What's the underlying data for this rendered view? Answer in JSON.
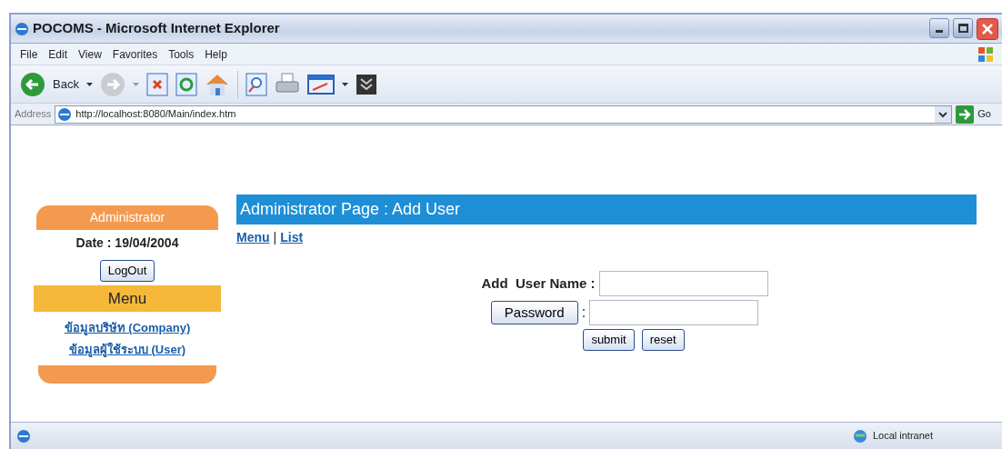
{
  "window": {
    "title": "POCOMS - Microsoft Internet Explorer"
  },
  "menu_bar": [
    "File",
    "Edit",
    "View",
    "Favorites",
    "Tools",
    "Help"
  ],
  "toolbar": {
    "back_label": "Back"
  },
  "address_bar": {
    "label": "Address",
    "url": "http://localhost:8080/Main/index.htm",
    "go_label": "Go"
  },
  "sidebar": {
    "role": "Administrator",
    "date": "Date : 19/04/2004",
    "logout": "LogOut",
    "menu_title": "Menu",
    "links": [
      "ข้อมูลบริษัท (Company)",
      "ข้อมูลผู้ใช้ระบบ (User)"
    ]
  },
  "page": {
    "title": "Administrator Page : Add User",
    "nav_links": [
      "Menu",
      "List"
    ],
    "separator": "|"
  },
  "form": {
    "username_label": "Add  User Name :",
    "password_button": "Password",
    "password_colon": ":",
    "buttons": [
      "submit",
      "reset"
    ]
  },
  "status_bar": {
    "zone": "Local intranet"
  }
}
